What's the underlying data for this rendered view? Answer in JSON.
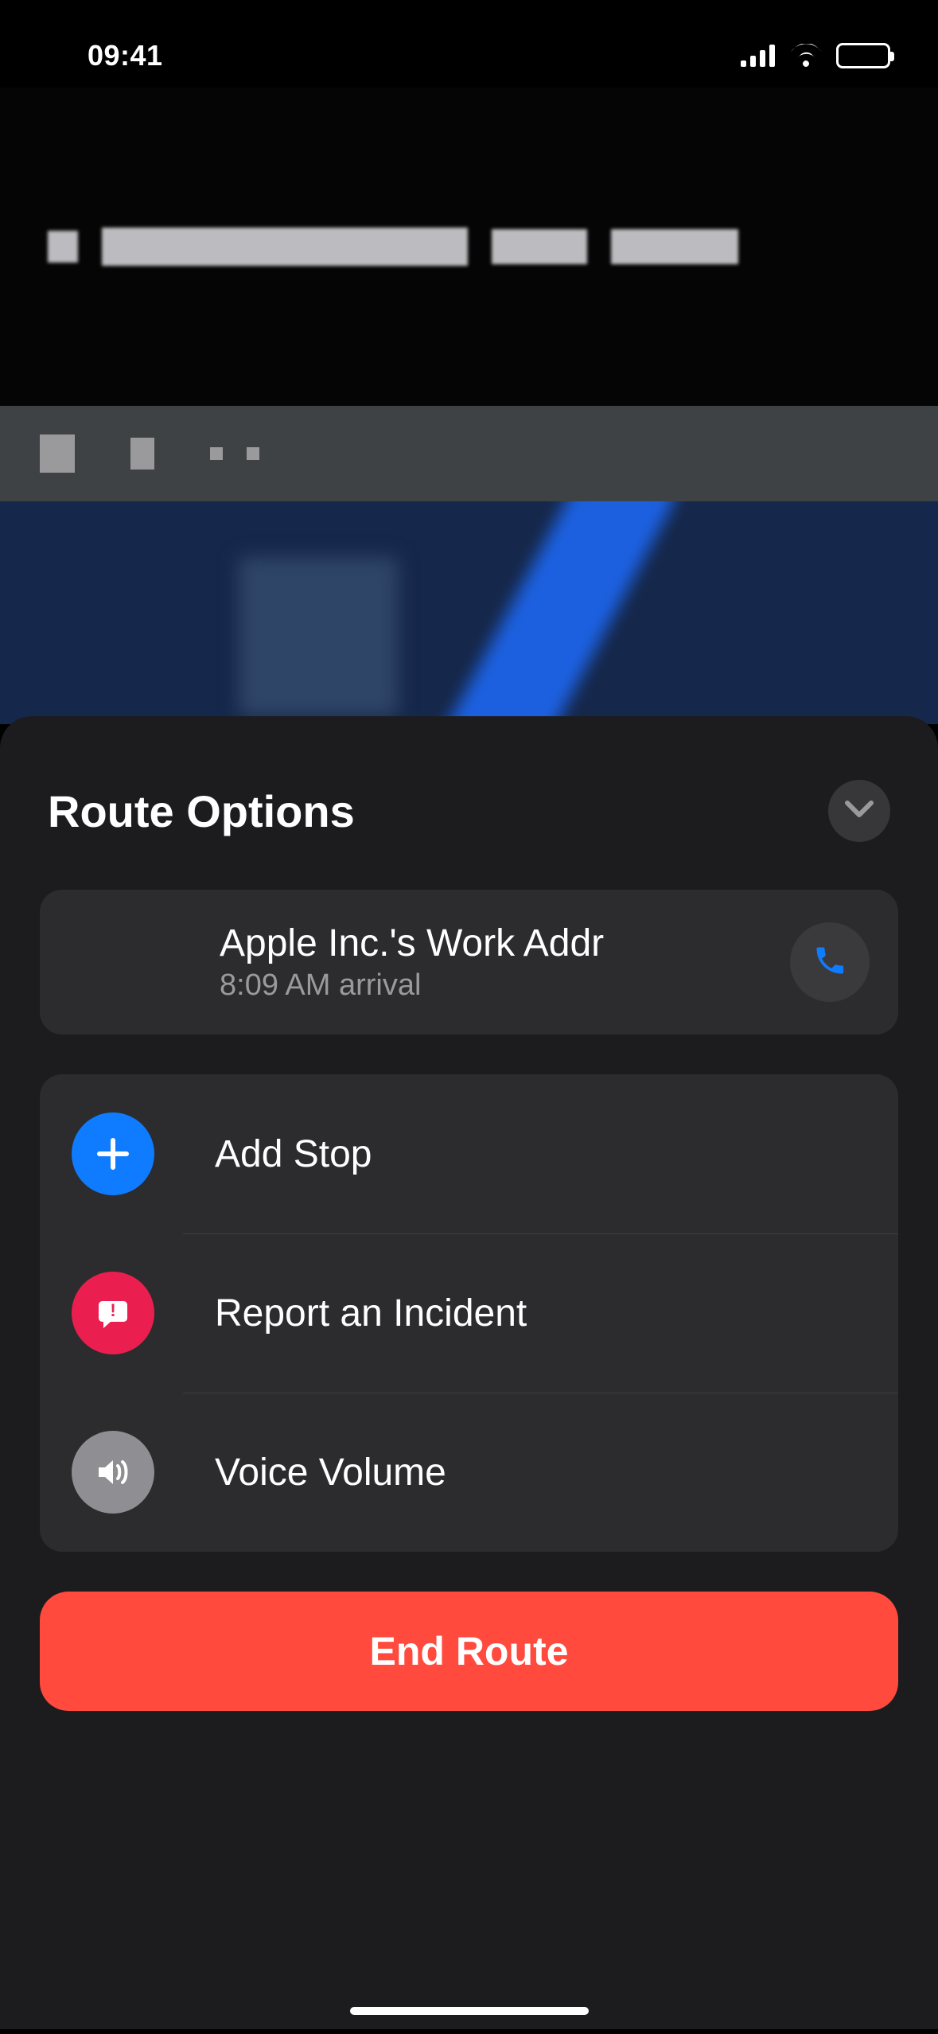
{
  "status": {
    "time": "09:41"
  },
  "sheet": {
    "title": "Route Options"
  },
  "destination": {
    "name": "Apple Inc.'s Work Addr",
    "arrival": "8:09 AM arrival"
  },
  "options": [
    {
      "label": "Add Stop"
    },
    {
      "label": "Report an Incident"
    },
    {
      "label": "Voice Volume"
    }
  ],
  "end_button": "End Route",
  "colors": {
    "accent_blue": "#0f7cff",
    "incident_red": "#eb1f4f",
    "end_red": "#ff4a3d",
    "sheet_bg": "#1c1c1e",
    "card_bg": "#2c2c2e"
  }
}
